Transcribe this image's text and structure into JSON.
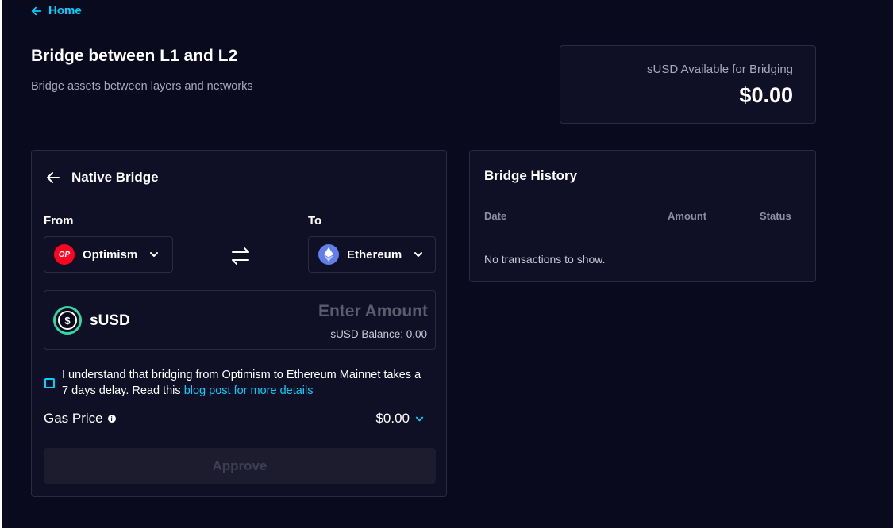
{
  "nav": {
    "home_label": "Home"
  },
  "header": {
    "title": "Bridge between L1 and L2",
    "subtitle": "Bridge assets between layers and networks"
  },
  "available": {
    "label": "sUSD Available for Bridging",
    "value": "$0.00"
  },
  "bridge": {
    "title": "Native Bridge",
    "from_label": "From",
    "to_label": "To",
    "from_network": {
      "name": "Optimism",
      "logo_text": "OP",
      "color": "#ff0420"
    },
    "to_network": {
      "name": "Ethereum",
      "color": "#627eea"
    },
    "token": {
      "symbol": "sUSD",
      "logo_glyph": "$"
    },
    "amount_placeholder": "Enter Amount",
    "balance": "sUSD Balance: 0.00",
    "agreement_text": "I understand that bridging from Optimism to Ethereum Mainnet takes a 7 days delay. Read this",
    "agreement_link": "blog post for more details",
    "agreement_checked": false,
    "gas_label": "Gas Price",
    "gas_value": "$0.00",
    "approve_label": "Approve"
  },
  "history": {
    "title": "Bridge History",
    "columns": [
      "Date",
      "Amount",
      "Status"
    ],
    "empty_message": "No transactions to show."
  },
  "colors": {
    "background": "#0a0a1f",
    "card": "#0f0f25",
    "border": "#2b2b40",
    "accent": "#00d1ff",
    "susd_ring": "#31d8a4"
  }
}
